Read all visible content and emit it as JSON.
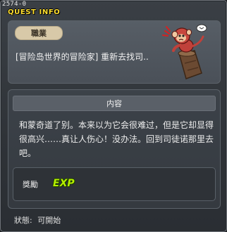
{
  "window": {
    "id_tag": "2574-0",
    "title": "QUEST INFO"
  },
  "job": {
    "badge": "職業",
    "text": "[冒险岛世界的冒险家] 重新去找司.."
  },
  "content": {
    "header": "内容",
    "description": "和蒙奇道了别。本来以为它会很难过，但是它却显得很高兴……真让人伤心！没办法。回到司徒诺那里去吧。"
  },
  "reward": {
    "label": "獎勵",
    "exp_text": "EXP"
  },
  "status": {
    "label": "狀態:",
    "value": "可開始"
  },
  "colors": {
    "title": "#ffdf30",
    "exp": "#b6f000",
    "badge_bg": "#d8c9a8"
  }
}
